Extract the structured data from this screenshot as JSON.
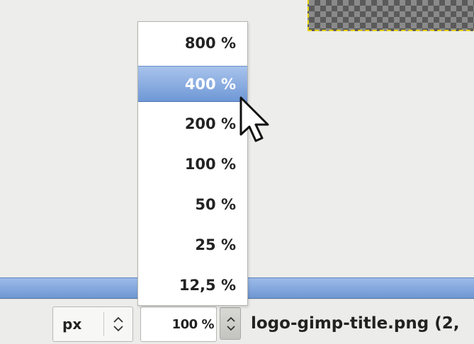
{
  "zoom_menu": {
    "items": [
      {
        "label": "800 %"
      },
      {
        "label": "400 %",
        "selected": true
      },
      {
        "label": "200 %"
      },
      {
        "label": "100 %"
      },
      {
        "label": "50 %"
      },
      {
        "label": "25 %"
      },
      {
        "label": "12,5 %"
      }
    ]
  },
  "statusbar": {
    "unit": "px",
    "zoom_value": "100 %",
    "filename": "logo-gimp-title.png (2,"
  },
  "colors": {
    "selection_blue": "#6f98d6",
    "checker_dark": "#5a5a5a",
    "layer_boundary": "#e6d200"
  }
}
